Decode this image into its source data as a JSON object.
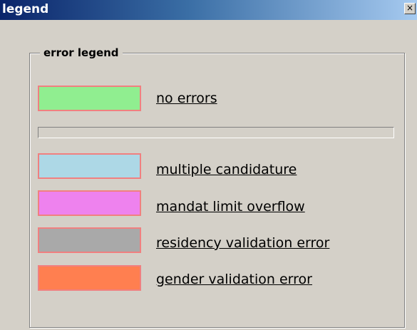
{
  "window": {
    "title": "legend",
    "close_glyph": "×"
  },
  "group": {
    "title": "error legend"
  },
  "items": [
    {
      "label": "no errors",
      "color": "#90ee90"
    },
    {
      "label": "multiple candidature",
      "color": "#add8e6"
    },
    {
      "label": "mandat limit overflow",
      "color": "#ee82ee"
    },
    {
      "label": "residency validation error",
      "color": "#a9a9a9"
    },
    {
      "label": "gender validation error",
      "color": "#ff7f50"
    }
  ],
  "colors": {
    "swatch_border": "#f08080",
    "titlebar_start": "#0a246a",
    "titlebar_end": "#a6caf0",
    "background": "#d4d0c8"
  }
}
